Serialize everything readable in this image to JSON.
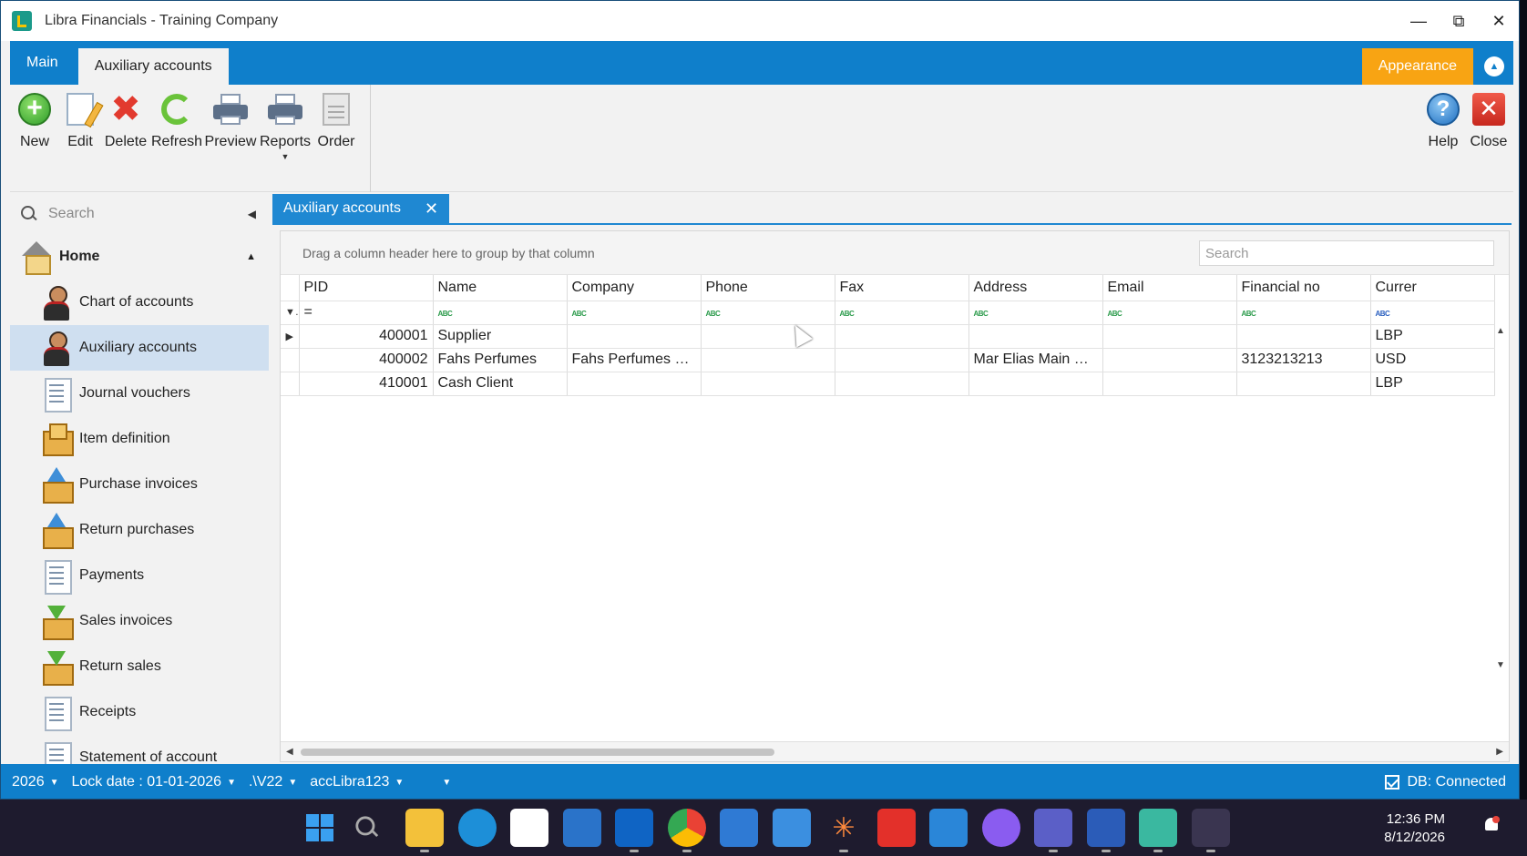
{
  "window": {
    "title": "Libra Financials - Training Company"
  },
  "ribbon_tabs": [
    {
      "label": "Main"
    },
    {
      "label": "Auxiliary accounts"
    }
  ],
  "appearance_label": "Appearance",
  "toolbar": {
    "new": "New",
    "edit": "Edit",
    "delete": "Delete",
    "refresh": "Refresh",
    "preview": "Preview",
    "reports": "Reports",
    "order": "Order",
    "help": "Help",
    "close": "Close"
  },
  "sidebar": {
    "search_placeholder": "Search",
    "home_label": "Home",
    "items": [
      {
        "label": "Chart of accounts",
        "icon": "person-icon"
      },
      {
        "label": "Auxiliary accounts",
        "icon": "person-icon"
      },
      {
        "label": "Journal vouchers",
        "icon": "document-icon"
      },
      {
        "label": "Item definition",
        "icon": "box-icon"
      },
      {
        "label": "Purchase invoices",
        "icon": "upload-box-icon"
      },
      {
        "label": "Return purchases",
        "icon": "upload-box-icon"
      },
      {
        "label": "Payments",
        "icon": "document-icon"
      },
      {
        "label": "Sales invoices",
        "icon": "download-box-icon"
      },
      {
        "label": "Return sales",
        "icon": "download-box-icon"
      },
      {
        "label": "Receipts",
        "icon": "document-icon"
      },
      {
        "label": "Statement of account",
        "icon": "document-icon"
      }
    ]
  },
  "doc_tab": {
    "label": "Auxiliary accounts"
  },
  "grid": {
    "group_hint": "Drag a column header here to group by that column",
    "search_placeholder": "Search",
    "columns": [
      "PID",
      "Name",
      "Company",
      "Phone",
      "Fax",
      "Address",
      "Email",
      "Financial no",
      "Currer"
    ],
    "filter_equals": "=",
    "filter_abc": "ABC",
    "rows": [
      {
        "pid": "400001",
        "name": "Supplier",
        "company": "",
        "phone": "",
        "fax": "",
        "address": "",
        "email": "",
        "financial_no": "",
        "currency": "LBP"
      },
      {
        "pid": "400002",
        "name": "Fahs Perfumes",
        "company": "Fahs Perfumes LTD",
        "phone": "",
        "fax": "",
        "address": "Mar Elias Main Roa...",
        "email": "",
        "financial_no": "3123213213",
        "currency": "USD"
      },
      {
        "pid": "410001",
        "name": "Cash Client",
        "company": "",
        "phone": "",
        "fax": "",
        "address": "",
        "email": "",
        "financial_no": "",
        "currency": "LBP"
      }
    ]
  },
  "statusbar": {
    "year": "2026",
    "lock_date": "Lock date : 01-01-2026",
    "server": ".\\V22",
    "database": "accLibra123",
    "db_status": "DB: Connected"
  },
  "taskbar": {
    "time": "12:36 PM",
    "date": "8/12/2026",
    "apps": [
      "start-icon",
      "search-icon",
      "file-explorer-icon",
      "edge-icon",
      "store-icon",
      "mail-icon",
      "outlook-icon",
      "chrome-icon",
      "app-icon",
      "photos-icon",
      "spark-icon",
      "anydesk-icon",
      "vscode-icon",
      "app-icon",
      "teams-icon",
      "word-icon",
      "notepad-icon",
      "libra-icon"
    ]
  },
  "colors": {
    "accent": "#0f7fcb",
    "appearance": "#f8a413",
    "selected_nav": "#cfdff0"
  }
}
